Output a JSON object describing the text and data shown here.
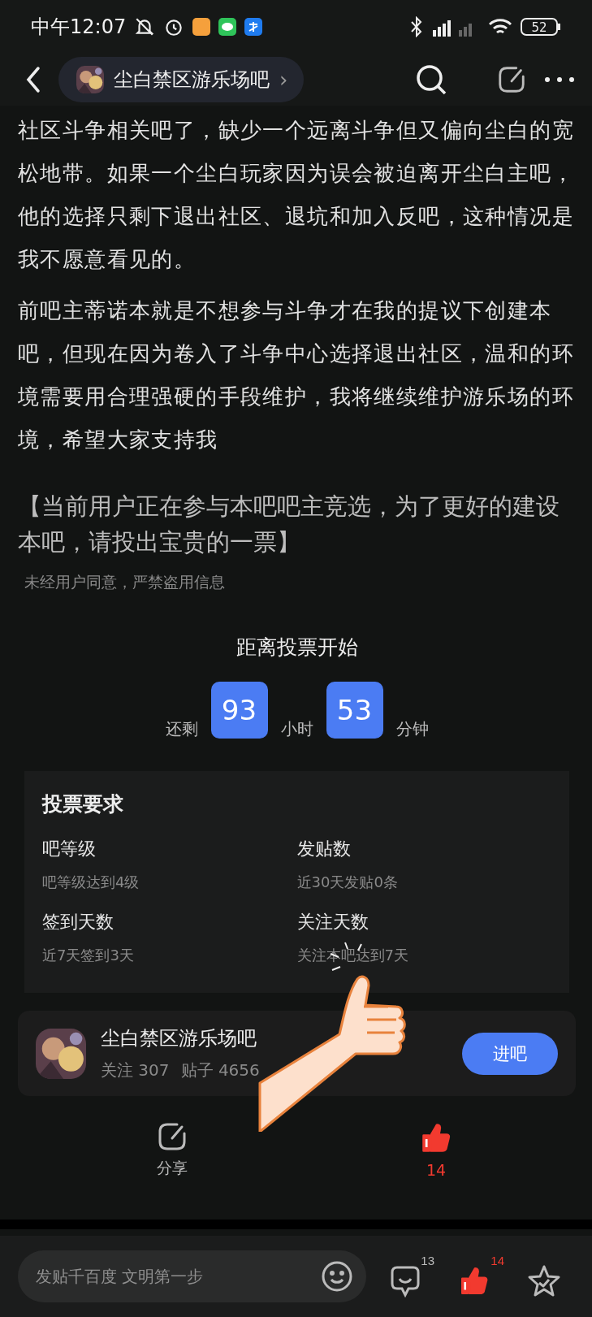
{
  "status_bar": {
    "time": "中午12:07",
    "battery": "52"
  },
  "nav": {
    "forum": "尘白禁区游乐场吧",
    "chevron": "›"
  },
  "paragraphs": [
    "社区斗争相关吧了，缺少一个远离斗争但又偏向尘白的宽松地带。如果一个尘白玩家因为误会被迫离开尘白主吧，他的选择只剩下退出社区、退坑和加入反吧，这种情况是我不愿意看见的。",
    "前吧主蒂诺本就是不想参与斗争才在我的提议下创建本吧，但现在因为卷入了斗争中心选择退出社区，温和的环境需要用合理强硬的手段维护，我将继续维护游乐场的环境，希望大家支持我"
  ],
  "notice": "【当前用户正在参与本吧吧主竞选，为了更好的建设本吧，请投出宝贵的一票】",
  "disclaimer": "未经用户同意，严禁盗用信息",
  "countdown": {
    "title": "距离投票开始",
    "prefix": "还剩",
    "hours": "93",
    "hours_unit": "小时",
    "minutes": "53",
    "minutes_unit": "分钟"
  },
  "requirements": {
    "title": "投票要求",
    "items": [
      {
        "name": "吧等级",
        "detail": "吧等级达到4级"
      },
      {
        "name": "发贴数",
        "detail": "近30天发贴0条"
      },
      {
        "name": "签到天数",
        "detail": "近7天签到3天"
      },
      {
        "name": "关注天数",
        "detail": "关注本吧达到7天"
      }
    ]
  },
  "forum_card": {
    "name": "尘白禁区游乐场吧",
    "follow": "关注 307",
    "posts": "贴子 4656",
    "button": "进吧"
  },
  "actions": {
    "share": "分享",
    "likes": "14",
    "liked": true
  },
  "bottom_bar": {
    "placeholder": "发贴千百度 文明第一步",
    "comments": "13",
    "likes": "14",
    "liked": true
  }
}
